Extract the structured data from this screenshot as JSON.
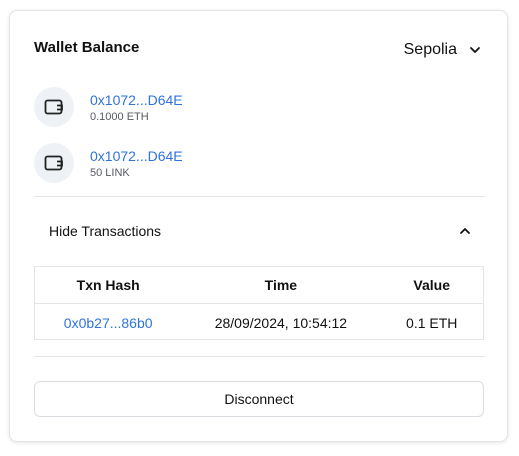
{
  "wallet": {
    "title": "Wallet Balance",
    "network": "Sepolia"
  },
  "accounts": [
    {
      "address": "0x1072...D64E",
      "balance": "0.1000 ETH"
    },
    {
      "address": "0x1072...D64E",
      "balance": "50 LINK"
    }
  ],
  "transactions": {
    "toggle_label": "Hide Transactions",
    "headers": [
      "Txn Hash",
      "Time",
      "Value"
    ],
    "rows": [
      {
        "hash": "0x0b27...86b0",
        "time": "28/09/2024, 10:54:12",
        "value": "0.1 ETH"
      }
    ]
  },
  "actions": {
    "disconnect_label": "Disconnect"
  },
  "colors": {
    "link": "#2f73e0",
    "border": "#e2e4e8",
    "icon_bg": "#eef1f5"
  },
  "icons": {
    "network_dropdown": "chevron-down-icon",
    "account": "wallet-icon",
    "toggle": "chevron-up-icon"
  }
}
